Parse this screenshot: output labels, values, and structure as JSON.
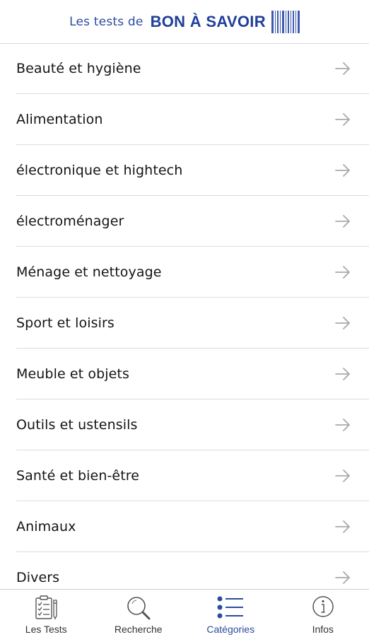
{
  "header": {
    "prefix": "Les tests de",
    "brand": "BON À SAVOIR",
    "logo_icon": "barcode-icon",
    "brand_color": "#1f3f99"
  },
  "categories": [
    {
      "label": "Beauté et hygiène"
    },
    {
      "label": "Alimentation"
    },
    {
      "label": "électronique et hightech"
    },
    {
      "label": "électroménager"
    },
    {
      "label": "Ménage et nettoyage"
    },
    {
      "label": "Sport et loisirs"
    },
    {
      "label": "Meuble et objets"
    },
    {
      "label": "Outils et ustensils"
    },
    {
      "label": "Santé et bien-être"
    },
    {
      "label": "Animaux"
    },
    {
      "label": "Divers"
    }
  ],
  "row_icon": "arrow-right-icon",
  "tabs": [
    {
      "label": "Les Tests",
      "icon": "clipboard-checklist-icon",
      "active": false
    },
    {
      "label": "Recherche",
      "icon": "search-icon",
      "active": false
    },
    {
      "label": "Catégories",
      "icon": "list-icon",
      "active": true
    },
    {
      "label": "Infos",
      "icon": "info-icon",
      "active": false
    }
  ],
  "colors": {
    "accent": "#2d4b9e",
    "arrow": "#a9a9a9",
    "inactive_icon": "#555555"
  }
}
